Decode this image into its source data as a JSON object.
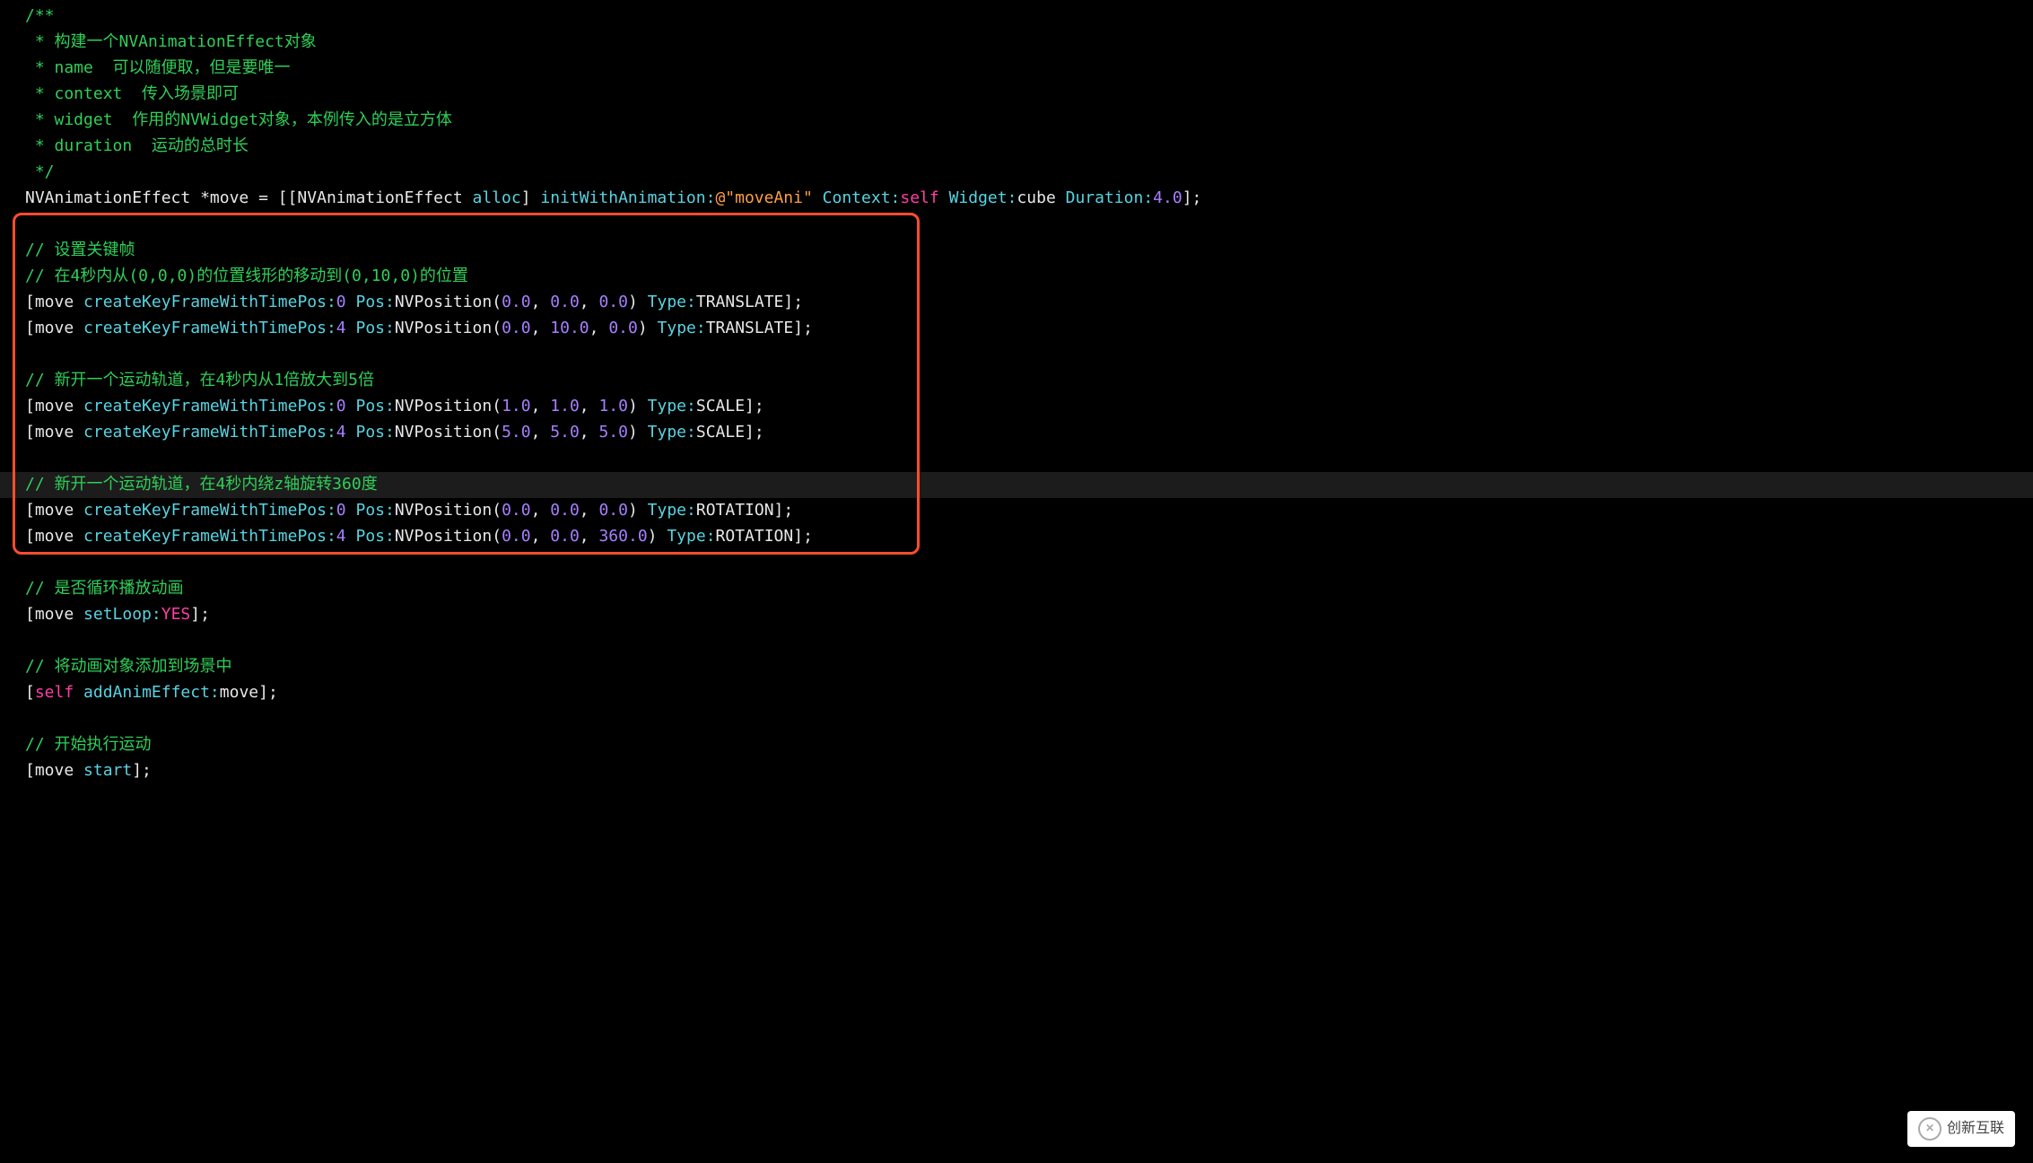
{
  "lines": [
    {
      "cls": "",
      "spans": [
        {
          "c": "tok-comment",
          "t": "/**"
        }
      ]
    },
    {
      "cls": "",
      "spans": [
        {
          "c": "tok-comment",
          "t": " * 构建一个NVAnimationEffect对象"
        }
      ]
    },
    {
      "cls": "",
      "spans": [
        {
          "c": "tok-comment",
          "t": " * name  可以随便取，但是要唯一"
        }
      ]
    },
    {
      "cls": "",
      "spans": [
        {
          "c": "tok-comment",
          "t": " * context  传入场景即可"
        }
      ]
    },
    {
      "cls": "",
      "spans": [
        {
          "c": "tok-comment",
          "t": " * widget  作用的NVWidget对象，本例传入的是立方体"
        }
      ]
    },
    {
      "cls": "",
      "spans": [
        {
          "c": "tok-comment",
          "t": " * duration  运动的总时长"
        }
      ]
    },
    {
      "cls": "",
      "spans": [
        {
          "c": "tok-comment",
          "t": " */"
        }
      ]
    },
    {
      "cls": "",
      "spans": [
        {
          "c": "tok-default",
          "t": "NVAnimationEffect *move = [[NVAnimationEffect "
        },
        {
          "c": "tok-method",
          "t": "alloc"
        },
        {
          "c": "tok-default",
          "t": "] "
        },
        {
          "c": "tok-method",
          "t": "initWithAnimation:"
        },
        {
          "c": "tok-string",
          "t": "@\"moveAni\""
        },
        {
          "c": "tok-default",
          "t": " "
        },
        {
          "c": "tok-method",
          "t": "Context:"
        },
        {
          "c": "tok-magenta",
          "t": "self"
        },
        {
          "c": "tok-default",
          "t": " "
        },
        {
          "c": "tok-method",
          "t": "Widget:"
        },
        {
          "c": "tok-default",
          "t": "cube "
        },
        {
          "c": "tok-method",
          "t": "Duration:"
        },
        {
          "c": "tok-number",
          "t": "4.0"
        },
        {
          "c": "tok-default",
          "t": "];"
        }
      ]
    },
    {
      "cls": "",
      "spans": [
        {
          "c": "tok-default",
          "t": ""
        }
      ]
    },
    {
      "cls": "",
      "spans": [
        {
          "c": "tok-comment",
          "t": "// 设置关键帧"
        }
      ]
    },
    {
      "cls": "",
      "spans": [
        {
          "c": "tok-comment",
          "t": "// 在4秒内从(0,0,0)的位置线形的移动到(0,10,0)的位置"
        }
      ]
    },
    {
      "cls": "",
      "spans": [
        {
          "c": "tok-default",
          "t": "[move "
        },
        {
          "c": "tok-method",
          "t": "createKeyFrameWithTimePos:"
        },
        {
          "c": "tok-number",
          "t": "0"
        },
        {
          "c": "tok-default",
          "t": " "
        },
        {
          "c": "tok-method",
          "t": "Pos:"
        },
        {
          "c": "tok-default",
          "t": "NVPosition("
        },
        {
          "c": "tok-number",
          "t": "0.0"
        },
        {
          "c": "tok-default",
          "t": ", "
        },
        {
          "c": "tok-number",
          "t": "0.0"
        },
        {
          "c": "tok-default",
          "t": ", "
        },
        {
          "c": "tok-number",
          "t": "0.0"
        },
        {
          "c": "tok-default",
          "t": ") "
        },
        {
          "c": "tok-method",
          "t": "Type:"
        },
        {
          "c": "tok-default",
          "t": "TRANSLATE];"
        }
      ]
    },
    {
      "cls": "",
      "spans": [
        {
          "c": "tok-default",
          "t": "[move "
        },
        {
          "c": "tok-method",
          "t": "createKeyFrameWithTimePos:"
        },
        {
          "c": "tok-number",
          "t": "4"
        },
        {
          "c": "tok-default",
          "t": " "
        },
        {
          "c": "tok-method",
          "t": "Pos:"
        },
        {
          "c": "tok-default",
          "t": "NVPosition("
        },
        {
          "c": "tok-number",
          "t": "0.0"
        },
        {
          "c": "tok-default",
          "t": ", "
        },
        {
          "c": "tok-number",
          "t": "10.0"
        },
        {
          "c": "tok-default",
          "t": ", "
        },
        {
          "c": "tok-number",
          "t": "0.0"
        },
        {
          "c": "tok-default",
          "t": ") "
        },
        {
          "c": "tok-method",
          "t": "Type:"
        },
        {
          "c": "tok-default",
          "t": "TRANSLATE];"
        }
      ]
    },
    {
      "cls": "",
      "spans": [
        {
          "c": "tok-default",
          "t": ""
        }
      ]
    },
    {
      "cls": "",
      "spans": [
        {
          "c": "tok-comment",
          "t": "// 新开一个运动轨道，在4秒内从1倍放大到5倍"
        }
      ]
    },
    {
      "cls": "",
      "spans": [
        {
          "c": "tok-default",
          "t": "[move "
        },
        {
          "c": "tok-method",
          "t": "createKeyFrameWithTimePos:"
        },
        {
          "c": "tok-number",
          "t": "0"
        },
        {
          "c": "tok-default",
          "t": " "
        },
        {
          "c": "tok-method",
          "t": "Pos:"
        },
        {
          "c": "tok-default",
          "t": "NVPosition("
        },
        {
          "c": "tok-number",
          "t": "1.0"
        },
        {
          "c": "tok-default",
          "t": ", "
        },
        {
          "c": "tok-number",
          "t": "1.0"
        },
        {
          "c": "tok-default",
          "t": ", "
        },
        {
          "c": "tok-number",
          "t": "1.0"
        },
        {
          "c": "tok-default",
          "t": ") "
        },
        {
          "c": "tok-method",
          "t": "Type:"
        },
        {
          "c": "tok-default",
          "t": "SCALE];"
        }
      ]
    },
    {
      "cls": "",
      "spans": [
        {
          "c": "tok-default",
          "t": "[move "
        },
        {
          "c": "tok-method",
          "t": "createKeyFrameWithTimePos:"
        },
        {
          "c": "tok-number",
          "t": "4"
        },
        {
          "c": "tok-default",
          "t": " "
        },
        {
          "c": "tok-method",
          "t": "Pos:"
        },
        {
          "c": "tok-default",
          "t": "NVPosition("
        },
        {
          "c": "tok-number",
          "t": "5.0"
        },
        {
          "c": "tok-default",
          "t": ", "
        },
        {
          "c": "tok-number",
          "t": "5.0"
        },
        {
          "c": "tok-default",
          "t": ", "
        },
        {
          "c": "tok-number",
          "t": "5.0"
        },
        {
          "c": "tok-default",
          "t": ") "
        },
        {
          "c": "tok-method",
          "t": "Type:"
        },
        {
          "c": "tok-default",
          "t": "SCALE];"
        }
      ]
    },
    {
      "cls": "",
      "spans": [
        {
          "c": "tok-default",
          "t": ""
        }
      ]
    },
    {
      "cls": "hl",
      "spans": [
        {
          "c": "tok-comment",
          "t": "// 新开一个运动轨道，在4秒内绕z轴旋转360度"
        }
      ]
    },
    {
      "cls": "",
      "spans": [
        {
          "c": "tok-default",
          "t": "[move "
        },
        {
          "c": "tok-method",
          "t": "createKeyFrameWithTimePos:"
        },
        {
          "c": "tok-number",
          "t": "0"
        },
        {
          "c": "tok-default",
          "t": " "
        },
        {
          "c": "tok-method",
          "t": "Pos:"
        },
        {
          "c": "tok-default",
          "t": "NVPosition("
        },
        {
          "c": "tok-number",
          "t": "0.0"
        },
        {
          "c": "tok-default",
          "t": ", "
        },
        {
          "c": "tok-number",
          "t": "0.0"
        },
        {
          "c": "tok-default",
          "t": ", "
        },
        {
          "c": "tok-number",
          "t": "0.0"
        },
        {
          "c": "tok-default",
          "t": ") "
        },
        {
          "c": "tok-method",
          "t": "Type:"
        },
        {
          "c": "tok-default",
          "t": "ROTATION];"
        }
      ]
    },
    {
      "cls": "",
      "spans": [
        {
          "c": "tok-default",
          "t": "[move "
        },
        {
          "c": "tok-method",
          "t": "createKeyFrameWithTimePos:"
        },
        {
          "c": "tok-number",
          "t": "4"
        },
        {
          "c": "tok-default",
          "t": " "
        },
        {
          "c": "tok-method",
          "t": "Pos:"
        },
        {
          "c": "tok-default",
          "t": "NVPosition("
        },
        {
          "c": "tok-number",
          "t": "0.0"
        },
        {
          "c": "tok-default",
          "t": ", "
        },
        {
          "c": "tok-number",
          "t": "0.0"
        },
        {
          "c": "tok-default",
          "t": ", "
        },
        {
          "c": "tok-number",
          "t": "360.0"
        },
        {
          "c": "tok-default",
          "t": ") "
        },
        {
          "c": "tok-method",
          "t": "Type:"
        },
        {
          "c": "tok-default",
          "t": "ROTATION];"
        }
      ]
    },
    {
      "cls": "",
      "spans": [
        {
          "c": "tok-default",
          "t": ""
        }
      ]
    },
    {
      "cls": "",
      "spans": [
        {
          "c": "tok-comment",
          "t": "// 是否循环播放动画"
        }
      ]
    },
    {
      "cls": "",
      "spans": [
        {
          "c": "tok-default",
          "t": "[move "
        },
        {
          "c": "tok-method",
          "t": "setLoop:"
        },
        {
          "c": "tok-magenta",
          "t": "YES"
        },
        {
          "c": "tok-default",
          "t": "];"
        }
      ]
    },
    {
      "cls": "",
      "spans": [
        {
          "c": "tok-default",
          "t": ""
        }
      ]
    },
    {
      "cls": "",
      "spans": [
        {
          "c": "tok-comment",
          "t": "// 将动画对象添加到场景中"
        }
      ]
    },
    {
      "cls": "",
      "spans": [
        {
          "c": "tok-default",
          "t": "["
        },
        {
          "c": "tok-magenta",
          "t": "self"
        },
        {
          "c": "tok-default",
          "t": " "
        },
        {
          "c": "tok-method",
          "t": "addAnimEffect:"
        },
        {
          "c": "tok-default",
          "t": "move];"
        }
      ]
    },
    {
      "cls": "",
      "spans": [
        {
          "c": "tok-default",
          "t": ""
        }
      ]
    },
    {
      "cls": "",
      "spans": [
        {
          "c": "tok-comment",
          "t": "// 开始执行运动"
        }
      ]
    },
    {
      "cls": "",
      "spans": [
        {
          "c": "tok-default",
          "t": "[move "
        },
        {
          "c": "tok-method",
          "t": "start"
        },
        {
          "c": "tok-default",
          "t": "];"
        }
      ]
    }
  ],
  "watermark": "创新互联"
}
